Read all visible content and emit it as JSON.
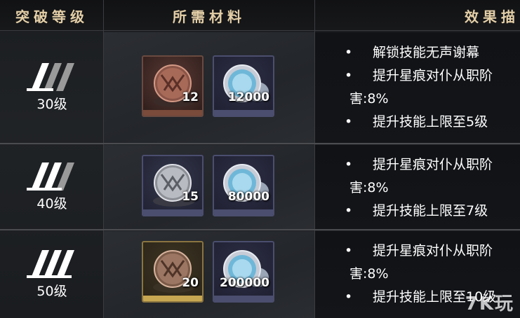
{
  "header": {
    "col1": "突破等级",
    "col2": "所需材料",
    "col3": "效果描"
  },
  "rows": [
    {
      "level": "30级",
      "slash_tier": 1,
      "materials": [
        {
          "icon": "bronze-emblem-icon",
          "count": "12",
          "rarity_color": "#7a4a3a"
        },
        {
          "icon": "silver-coin-icon",
          "count": "12000",
          "rarity_color": "#4b4e6e"
        }
      ],
      "effects": [
        "解锁技能无声谢幕",
        "提升星痕对仆从职阶",
        "害:8%",
        "提升技能上限至5级"
      ]
    },
    {
      "level": "40级",
      "slash_tier": 2,
      "materials": [
        {
          "icon": "silver-emblem-icon",
          "count": "15",
          "rarity_color": "#4b4e6e"
        },
        {
          "icon": "silver-coin-icon",
          "count": "80000",
          "rarity_color": "#4b4e6e"
        }
      ],
      "effects": [
        "提升星痕对仆从职阶",
        "害:8%",
        "提升技能上限至7级"
      ]
    },
    {
      "level": "50级",
      "slash_tier": 3,
      "materials": [
        {
          "icon": "gold-emblem-icon",
          "count": "20",
          "rarity_color": "#c8a752"
        },
        {
          "icon": "silver-coin-icon",
          "count": "200000",
          "rarity_color": "#4b4e6e"
        }
      ],
      "effects": [
        "提升星痕对仆从职阶",
        "害:8%",
        "提升技能上限至10级"
      ]
    }
  ],
  "watermark": "7K玩"
}
